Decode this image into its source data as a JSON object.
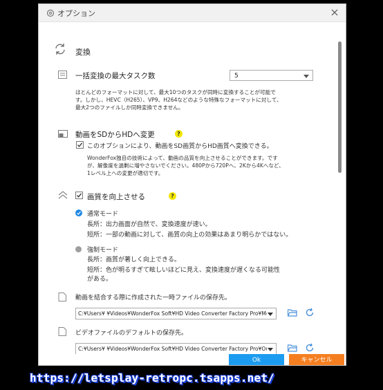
{
  "dialog": {
    "title": "オプション",
    "buttons": {
      "ok": "Ok",
      "cancel": "キャンセル"
    }
  },
  "convert": {
    "heading": "変換",
    "max_tasks_label": "一括変換の最大タスク数",
    "max_tasks_value": "5",
    "max_tasks_desc": [
      "ほとんどのフォーマットに対して、最大10つのタスクが同時に変換することが可能で",
      "す。しかし、HEVC（H265）、VP9、H264などのような特殊なフォーマットに対して、",
      "最大2つのファイルしか同時変換できません。"
    ]
  },
  "sd_to_hd": {
    "heading": "動画をSDからHDへ変更",
    "help": "?",
    "checkbox_label": "このオプションにより、動画をSD画質からHD画質へ変換できる。",
    "desc": [
      "WonderFox独自の技術によって、動画の品質を向上させることができます。です",
      "が、解像度を過剰に増やさないでください。480Pから720Pへ、2Kから4Kへなど、",
      "1レベル上への変更が適切です。"
    ]
  },
  "quality": {
    "heading": "画質を向上させる",
    "help": "?",
    "normal_mode": {
      "label": "通常モード",
      "pro": "長所：出力画面が自然で、変換速度が速い。",
      "con": "短所：一部の動画に対して、画質の向上の効果はあまり明らかではない。"
    },
    "force_mode": {
      "label": "強制モード",
      "pro": "長所：画質が著しく向上できる。",
      "con1": "短所：色が明るすぎて眩しいほどに見え、変換速度が遅くなる可能性",
      "con2": "がある。"
    }
  },
  "temp_folder": {
    "label": "動画を結合する際に作成された一時ファイルの保存先。",
    "path": "C:¥Users¥        ¥Videos¥WonderFox Soft¥HD Video Converter Factory Pro¥Me"
  },
  "default_folder": {
    "label": "ビデオファイルのデフォルトの保存先。",
    "path": "C:¥Users¥        ¥Videos¥WonderFox Soft¥HD Video Converter Factory Pro¥Ou"
  },
  "watermark": "https://letsplay-retropc.tsapps.net/",
  "colors": {
    "accent_blue": "#1c9cf0",
    "cancel_orange": "#f57f20",
    "help_yellow": "#f2e600",
    "radio_selected": "#1e88e5"
  }
}
